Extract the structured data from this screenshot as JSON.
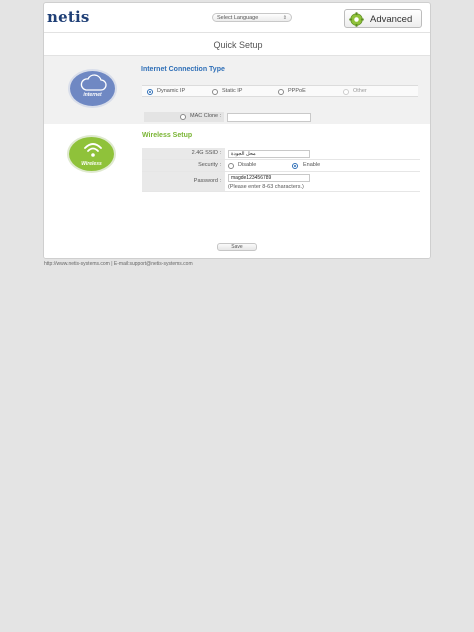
{
  "header": {
    "logo": "netis",
    "language_select": "Select Language",
    "language_arrows": "⇕",
    "advanced_label": "Advanced"
  },
  "page_title": "Quick Setup",
  "internet": {
    "icon_label": "internet",
    "heading": "Internet Connection Type",
    "options": [
      {
        "label": "Dynamic IP",
        "selected": true
      },
      {
        "label": "Static IP",
        "selected": false
      },
      {
        "label": "PPPoE",
        "selected": false
      },
      {
        "label": "Other",
        "selected": false
      }
    ],
    "mac_clone_label": "MAC Clone :",
    "mac_clone_value": ""
  },
  "wireless": {
    "icon_label": "Wireless",
    "heading": "Wireless Setup",
    "ssid_label": "2.4G SSID :",
    "ssid_value": "محل الجودة",
    "security_label": "Security :",
    "security_disable": "Disable",
    "security_enable": "Enable",
    "security_selected": "Enable",
    "password_label": "Password :",
    "password_value": "magde123456789",
    "password_hint": "(Please enter 8-63 characters.)"
  },
  "save_label": "Save",
  "footer": "http://www.netis-systems.com | E-mail:support@netis-systems.com",
  "colors": {
    "brand": "#1f3f76",
    "internet_accent": "#2f6fb7",
    "wireless_accent": "#7ab534",
    "internet_circle": "#6f88c3",
    "wireless_circle": "#8fc23a"
  }
}
